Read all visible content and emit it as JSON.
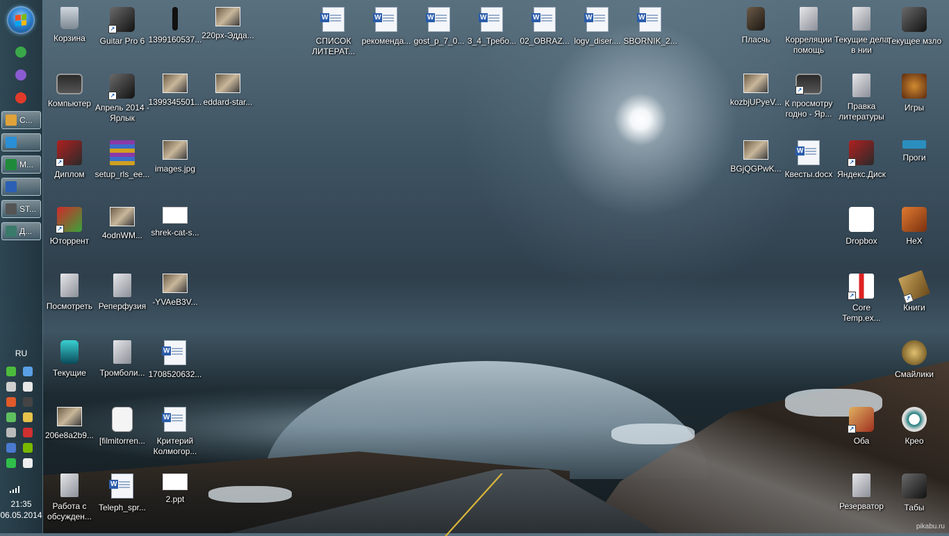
{
  "taskbar": {
    "pinned": [
      {
        "name": "pin-green-icon",
        "color": "#3aa84a"
      },
      {
        "name": "pin-vs-icon",
        "color": "#8a5bd3"
      },
      {
        "name": "pin-yandex-icon",
        "color": "#e23a2a"
      }
    ],
    "buttons": [
      {
        "label": "C...",
        "icon_color": "#e0a23a"
      },
      {
        "label": "",
        "icon_color": "#2a8fd6"
      },
      {
        "label": "M...",
        "icon_color": "#1f8a3b"
      },
      {
        "label": "",
        "icon_color": "#2b5fb3"
      },
      {
        "label": "ST...",
        "icon_color": "#555555"
      },
      {
        "label": "Д...",
        "icon_color": "#3a7a6a"
      }
    ],
    "language": "RU",
    "tray_icons": [
      {
        "name": "tray-utorrent-icon",
        "color": "#4cbb3c"
      },
      {
        "name": "tray-dropbox-icon",
        "color": "#5aa0e6"
      },
      {
        "name": "tray-window-icon",
        "color": "#d0d0d0"
      },
      {
        "name": "tray-pen-icon",
        "color": "#e8e8e8"
      },
      {
        "name": "tray-volume-icon",
        "color": "#e05a2a"
      },
      {
        "name": "tray-bell-icon",
        "color": "#444444"
      },
      {
        "name": "tray-update-icon",
        "color": "#5fc05f"
      },
      {
        "name": "tray-network-icon",
        "color": "#e6c24a"
      },
      {
        "name": "tray-monitor-icon",
        "color": "#bbbbbb"
      },
      {
        "name": "tray-blocked-icon",
        "color": "#d03030"
      },
      {
        "name": "tray-display-icon",
        "color": "#4a7ad0"
      },
      {
        "name": "tray-nvidia-icon",
        "color": "#78b900"
      },
      {
        "name": "tray-green-icon",
        "color": "#2fbf4a"
      },
      {
        "name": "tray-usb-icon",
        "color": "#eeeeee"
      }
    ],
    "time": "21:35",
    "date": "06.05.2014"
  },
  "desktop": {
    "icons": [
      {
        "label": "Корзина",
        "kind": "trash",
        "shortcut": false
      },
      {
        "label": "Guitar Pro 6",
        "kind": "dark",
        "shortcut": true
      },
      {
        "label": "1399160537...",
        "kind": "dark-slim",
        "shortcut": false
      },
      {
        "label": "220px-Эдда...",
        "kind": "photo",
        "shortcut": false
      },
      {
        "label": "СПИСОК ЛИТЕРАТ...",
        "kind": "doc",
        "shortcut": false
      },
      {
        "label": "рекоменда...",
        "kind": "doc",
        "shortcut": false
      },
      {
        "label": "gost_p_7_0...",
        "kind": "doc",
        "shortcut": false
      },
      {
        "label": "3_4_Требо...",
        "kind": "doc",
        "shortcut": false
      },
      {
        "label": "02_OBRAZ...",
        "kind": "doc",
        "shortcut": false
      },
      {
        "label": "logv_diser....",
        "kind": "doc",
        "shortcut": false
      },
      {
        "label": "SBORNIK_2...",
        "kind": "doc",
        "shortcut": false
      },
      {
        "label": "Пласчь",
        "kind": "folder-dark",
        "shortcut": false
      },
      {
        "label": "Корреляции помощь",
        "kind": "folder",
        "shortcut": false
      },
      {
        "label": "Текущие дела в нии",
        "kind": "folder",
        "shortcut": false
      },
      {
        "label": "Текущее мзло",
        "kind": "dark",
        "shortcut": false
      },
      {
        "label": "Компьютер",
        "kind": "monitor",
        "shortcut": false
      },
      {
        "label": "Апрель 2014 - Ярлык",
        "kind": "dark",
        "shortcut": true
      },
      {
        "label": "1399345501...",
        "kind": "photo",
        "shortcut": false
      },
      {
        "label": "eddard-star...",
        "kind": "photo",
        "shortcut": false
      },
      {
        "label": "kozbjUPyeV...",
        "kind": "photo",
        "shortcut": false
      },
      {
        "label": "К просмотру годно - Яр...",
        "kind": "monitor",
        "shortcut": true
      },
      {
        "label": "Правка литературы",
        "kind": "folder",
        "shortcut": false
      },
      {
        "label": "Игры",
        "kind": "games",
        "shortcut": false
      },
      {
        "label": "Диплом",
        "kind": "red-dark",
        "shortcut": true
      },
      {
        "label": "setup_rls_ee...",
        "kind": "archive",
        "shortcut": false
      },
      {
        "label": "images.jpg",
        "kind": "photo",
        "shortcut": false
      },
      {
        "label": "BGjQGPwK...",
        "kind": "photo",
        "shortcut": false
      },
      {
        "label": "Квесты.docx",
        "kind": "doc",
        "shortcut": false
      },
      {
        "label": "Яндекс.Диск",
        "kind": "red-dark",
        "shortcut": true
      },
      {
        "label": "Проги",
        "kind": "chip",
        "shortcut": false
      },
      {
        "label": "Юторрент",
        "kind": "torrent",
        "shortcut": true
      },
      {
        "label": "4odnWM...",
        "kind": "photo",
        "shortcut": false
      },
      {
        "label": "shrek-cat-s...",
        "kind": "white",
        "shortcut": false
      },
      {
        "label": "Dropbox",
        "kind": "dropbox",
        "shortcut": false
      },
      {
        "label": "HeX",
        "kind": "orange",
        "shortcut": false
      },
      {
        "label": "Посмотреть",
        "kind": "folder",
        "shortcut": false
      },
      {
        "label": "Реперфузия",
        "kind": "folder",
        "shortcut": false
      },
      {
        "label": "-YVAeB3V...",
        "kind": "photo",
        "shortcut": false
      },
      {
        "label": "Core Temp.ex...",
        "kind": "thermo",
        "shortcut": true
      },
      {
        "label": "Книги",
        "kind": "book",
        "shortcut": true
      },
      {
        "label": "Текущие",
        "kind": "teal",
        "shortcut": false
      },
      {
        "label": "Тромболи...",
        "kind": "folder",
        "shortcut": false
      },
      {
        "label": "1708520632...",
        "kind": "doc",
        "shortcut": false
      },
      {
        "label": "Смайлики",
        "kind": "medal",
        "shortcut": false
      },
      {
        "label": "206e8a2b9...",
        "kind": "photo",
        "shortcut": false
      },
      {
        "label": "[filmitorren...",
        "kind": "torrentfile",
        "shortcut": false
      },
      {
        "label": "Критерий Колмогор...",
        "kind": "doc",
        "shortcut": false
      },
      {
        "label": "Оба",
        "kind": "photos",
        "shortcut": true
      },
      {
        "label": "Крео",
        "kind": "gear",
        "shortcut": false
      },
      {
        "label": "Работа с обсужден...",
        "kind": "folder",
        "shortcut": false
      },
      {
        "label": "Teleph_spr...",
        "kind": "doc",
        "shortcut": false
      },
      {
        "label": "2.ppt",
        "kind": "white",
        "shortcut": false
      },
      {
        "label": "Резерватор",
        "kind": "folder",
        "shortcut": false
      },
      {
        "label": "Табы",
        "kind": "dark",
        "shortcut": false
      }
    ]
  },
  "watermark": "pikabu.ru"
}
